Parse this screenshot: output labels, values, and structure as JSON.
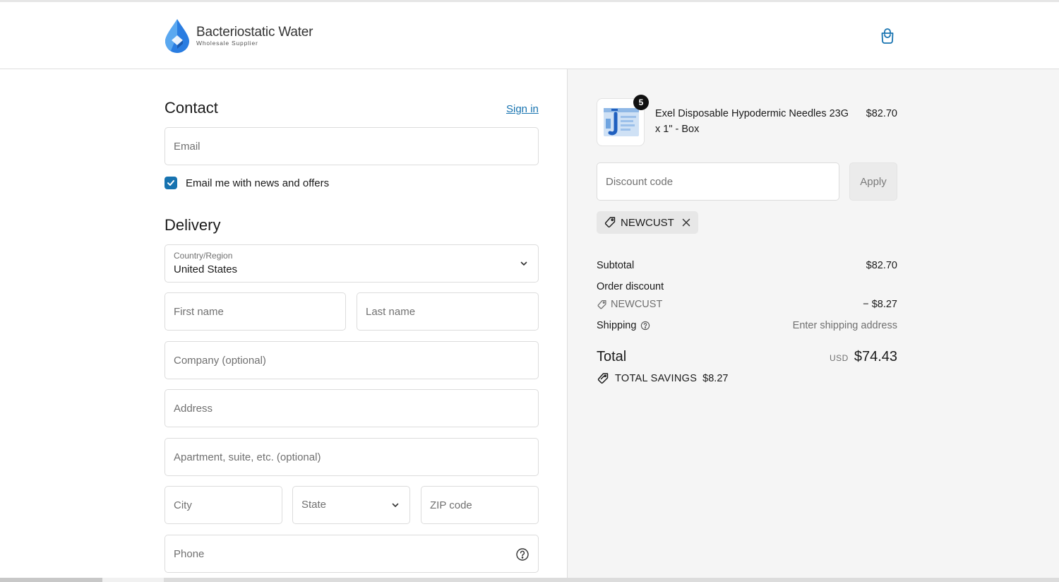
{
  "brand": {
    "name": "Bacteriostatic Water",
    "tagline": "Wholesale Supplier",
    "accent": "#1773b0",
    "logo_blue": "#2a7de1"
  },
  "header": {
    "cart_icon": "shopping-bag-icon"
  },
  "contact": {
    "heading": "Contact",
    "sign_in": "Sign in",
    "email_placeholder": "Email",
    "news_opt_in_label": "Email me with news and offers",
    "news_opt_in_checked": true
  },
  "delivery": {
    "heading": "Delivery",
    "country_label": "Country/Region",
    "country_value": "United States",
    "first_name_placeholder": "First name",
    "last_name_placeholder": "Last name",
    "company_placeholder": "Company (optional)",
    "address_placeholder": "Address",
    "apartment_placeholder": "Apartment, suite, etc. (optional)",
    "city_placeholder": "City",
    "state_placeholder": "State",
    "zip_placeholder": "ZIP code",
    "phone_placeholder": "Phone"
  },
  "summary": {
    "item": {
      "name": "Exel Disposable Hypodermic Needles 23G x 1\" - Box",
      "price": "$82.70",
      "quantity": "5"
    },
    "discount_placeholder": "Discount code",
    "apply_label": "Apply",
    "applied_code": "NEWCUST",
    "subtotal_label": "Subtotal",
    "subtotal_value": "$82.70",
    "order_discount_label": "Order discount",
    "discount_code": "NEWCUST",
    "discount_value": "− $8.27",
    "shipping_label": "Shipping",
    "shipping_value": "Enter shipping address",
    "total_label": "Total",
    "currency": "USD",
    "total_value": "$74.43",
    "savings_label": "TOTAL SAVINGS",
    "savings_value": "$8.27"
  }
}
